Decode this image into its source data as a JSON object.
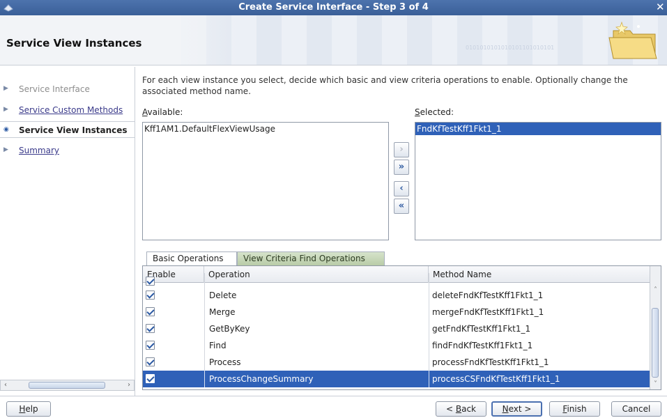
{
  "window": {
    "title": "Create Service Interface - Step 3 of 4",
    "close_glyph": "✕"
  },
  "header": {
    "page_title": "Service View Instances",
    "decoration_text": "0101010101010101101010101"
  },
  "nav": {
    "items": [
      {
        "label": "Service Interface",
        "state": "visited"
      },
      {
        "label": "Service Custom Methods",
        "state": "link"
      },
      {
        "label": "Service View Instances",
        "state": "current"
      },
      {
        "label": "Summary",
        "state": "link"
      }
    ]
  },
  "content": {
    "description": "For each view instance you select, decide which basic and view criteria operations to enable. Optionally change the associated method name.",
    "available_label_key": "A",
    "available_label_rest": "vailable:",
    "selected_label_key": "S",
    "selected_label_rest": "elected:",
    "available_items": [
      "Kff1AM1.DefaultFlexViewUsage"
    ],
    "selected_items": [
      "FndKfTestKff1Fkt1_1"
    ]
  },
  "shuttle": {
    "move": "›",
    "move_all": "»",
    "remove": "‹",
    "remove_all": "«"
  },
  "tabs": {
    "basic": "Basic Operations",
    "view_criteria": "View Criteria Find Operations",
    "active": "basic"
  },
  "table": {
    "columns": [
      "Enable",
      "Operation",
      "Method Name"
    ],
    "rows": [
      {
        "enabled": true,
        "operation": "",
        "method": ""
      },
      {
        "enabled": true,
        "operation": "Delete",
        "method": "deleteFndKfTestKff1Fkt1_1"
      },
      {
        "enabled": true,
        "operation": "Merge",
        "method": "mergeFndKfTestKff1Fkt1_1"
      },
      {
        "enabled": true,
        "operation": "GetByKey",
        "method": "getFndKfTestKff1Fkt1_1"
      },
      {
        "enabled": true,
        "operation": "Find",
        "method": "findFndKfTestKff1Fkt1_1"
      },
      {
        "enabled": true,
        "operation": "Process",
        "method": "processFndKfTestKff1Fkt1_1"
      },
      {
        "enabled": true,
        "operation": "ProcessChangeSummary",
        "method": "processCSFndKfTestKff1Fkt1_1",
        "selected": true
      }
    ]
  },
  "footer": {
    "help_key": "H",
    "help_rest": "elp",
    "back_prefix": "< ",
    "back_key": "B",
    "back_rest": "ack",
    "next_key": "N",
    "next_rest": "ext >",
    "finish_key": "F",
    "finish_rest": "inish",
    "cancel": "Cancel"
  },
  "colors": {
    "title_bar": "#3f65a1",
    "selection": "#2f61b8",
    "vc_tab": "#c4d5b4"
  }
}
